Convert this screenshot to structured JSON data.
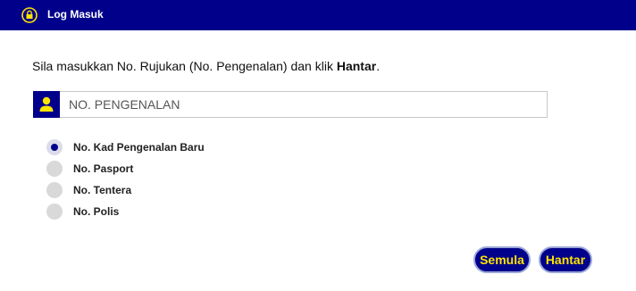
{
  "header": {
    "title": "Log Masuk",
    "icon": "lock-icon",
    "color": "#00008b"
  },
  "instruction": {
    "before": "Sila masukkan No. Rujukan (No. Pengenalan) dan klik ",
    "bold": "Hantar",
    "after": "."
  },
  "id_field": {
    "placeholder": "NO. PENGENALAN",
    "value": "",
    "icon": "user-icon"
  },
  "id_types": [
    {
      "label": "No. Kad Pengenalan Baru",
      "checked": true
    },
    {
      "label": "No. Pasport",
      "checked": false
    },
    {
      "label": "No. Tentera",
      "checked": false
    },
    {
      "label": "No. Polis",
      "checked": false
    }
  ],
  "buttons": {
    "reset": "Semula",
    "submit": "Hantar",
    "text_color": "#ffe400"
  }
}
